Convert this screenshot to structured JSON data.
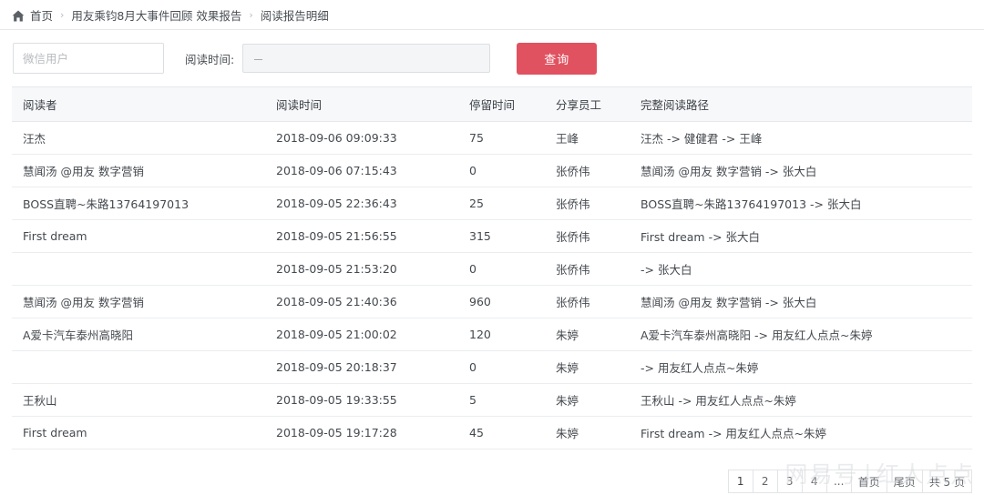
{
  "breadcrumb": {
    "home_icon": "home-icon",
    "separator": "›",
    "items": [
      {
        "label": "首页"
      },
      {
        "label": "用友乘钧8月大事件回顾 效果报告"
      },
      {
        "label": "阅读报告明细"
      }
    ]
  },
  "filter": {
    "user_input": {
      "value": "",
      "placeholder": "微信用户"
    },
    "time_label": "阅读时间:",
    "date_range": {
      "value": "－",
      "placeholder": "－"
    },
    "query_button": "查询",
    "button_color": "#e05260"
  },
  "table": {
    "columns": [
      {
        "key": "reader",
        "label": "阅读者"
      },
      {
        "key": "read_time",
        "label": "阅读时间"
      },
      {
        "key": "stay_time",
        "label": "停留时间"
      },
      {
        "key": "share_employee",
        "label": "分享员工"
      },
      {
        "key": "full_path",
        "label": "完整阅读路径"
      }
    ],
    "rows": [
      {
        "reader": "汪杰",
        "read_time": "2018-09-06 09:09:33",
        "stay_time": "75",
        "share_employee": "王峰",
        "full_path": "汪杰 -> 健健君 -> 王峰"
      },
      {
        "reader": "慧闻汤 @用友 数字营销",
        "read_time": "2018-09-06 07:15:43",
        "stay_time": "0",
        "share_employee": "张侨伟",
        "full_path": "慧闻汤 @用友 数字营销 -> 张大白"
      },
      {
        "reader": "BOSS直聘~朱路13764197013",
        "read_time": "2018-09-05 22:36:43",
        "stay_time": "25",
        "share_employee": "张侨伟",
        "full_path": "BOSS直聘~朱路13764197013 -> 张大白"
      },
      {
        "reader": "First dream",
        "read_time": "2018-09-05 21:56:55",
        "stay_time": "315",
        "share_employee": "张侨伟",
        "full_path": "First dream -> 张大白"
      },
      {
        "reader": "",
        "read_time": "2018-09-05 21:53:20",
        "stay_time": "0",
        "share_employee": "张侨伟",
        "full_path": "-> 张大白"
      },
      {
        "reader": "慧闻汤 @用友 数字营销",
        "read_time": "2018-09-05 21:40:36",
        "stay_time": "960",
        "share_employee": "张侨伟",
        "full_path": "慧闻汤 @用友 数字营销 -> 张大白"
      },
      {
        "reader": "A爱卡汽车泰州高晓阳",
        "read_time": "2018-09-05 21:00:02",
        "stay_time": "120",
        "share_employee": "朱婷",
        "full_path": "A爱卡汽车泰州高晓阳 -> 用友红人点点~朱婷"
      },
      {
        "reader": "",
        "read_time": "2018-09-05 20:18:37",
        "stay_time": "0",
        "share_employee": "朱婷",
        "full_path": "-> 用友红人点点~朱婷"
      },
      {
        "reader": "王秋山",
        "read_time": "2018-09-05 19:33:55",
        "stay_time": "5",
        "share_employee": "朱婷",
        "full_path": "王秋山 -> 用友红人点点~朱婷"
      },
      {
        "reader": "First dream",
        "read_time": "2018-09-05 19:17:28",
        "stay_time": "45",
        "share_employee": "朱婷",
        "full_path": "First dream -> 用友红人点点~朱婷"
      }
    ]
  },
  "pagination": {
    "pages": [
      "1",
      "2",
      "3",
      "4"
    ],
    "ellipsis": "...",
    "first_page": "首页",
    "last_page": "尾页",
    "total_text": "共 5 页",
    "current": "1"
  },
  "watermark": {
    "left": "网易号",
    "separator": "|",
    "right": "红人点点"
  }
}
